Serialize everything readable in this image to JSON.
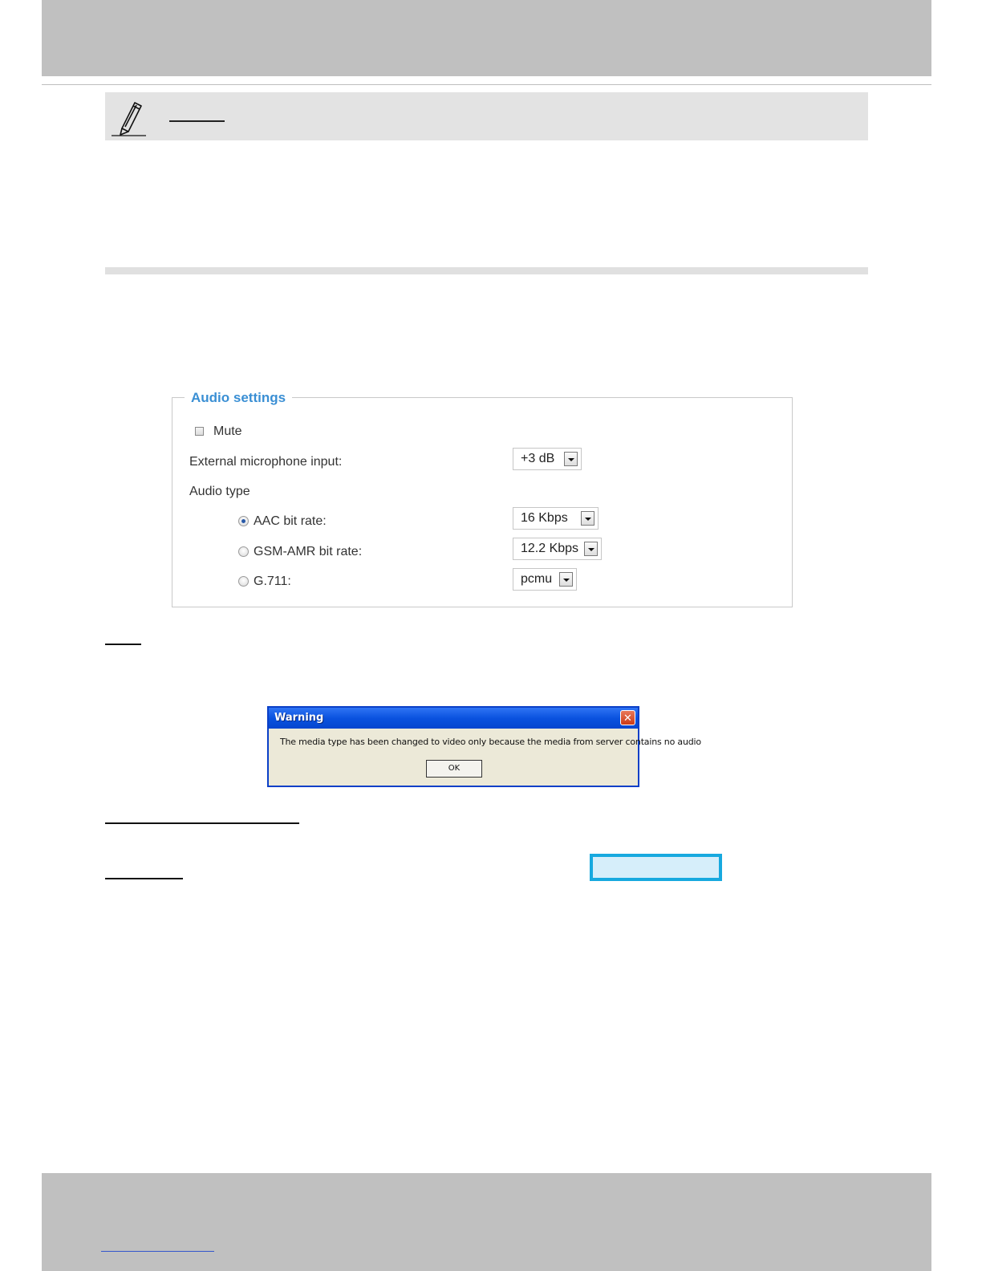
{
  "audio_settings": {
    "legend": "Audio settings",
    "mute_label": "Mute",
    "mute_checked": false,
    "mic_label": "External microphone input:",
    "mic_value": "+3 dB",
    "audio_type_label": "Audio type",
    "options": [
      {
        "label": "AAC bit rate:",
        "selected": true,
        "value": "16 Kbps"
      },
      {
        "label": "GSM-AMR bit rate:",
        "selected": false,
        "value": "12.2 Kbps"
      },
      {
        "label": "G.711:",
        "selected": false,
        "value": "pcmu"
      }
    ]
  },
  "warning_dialog": {
    "title": "Warning",
    "message": "The media type has been changed to video only because the media from server contains no audio",
    "ok_label": "OK",
    "close_glyph": "✕"
  },
  "colors": {
    "legend": "#3a8fd4",
    "titlebar": "#0a52df",
    "highlight_border": "#17a9df",
    "band": "#c0c0c0"
  }
}
